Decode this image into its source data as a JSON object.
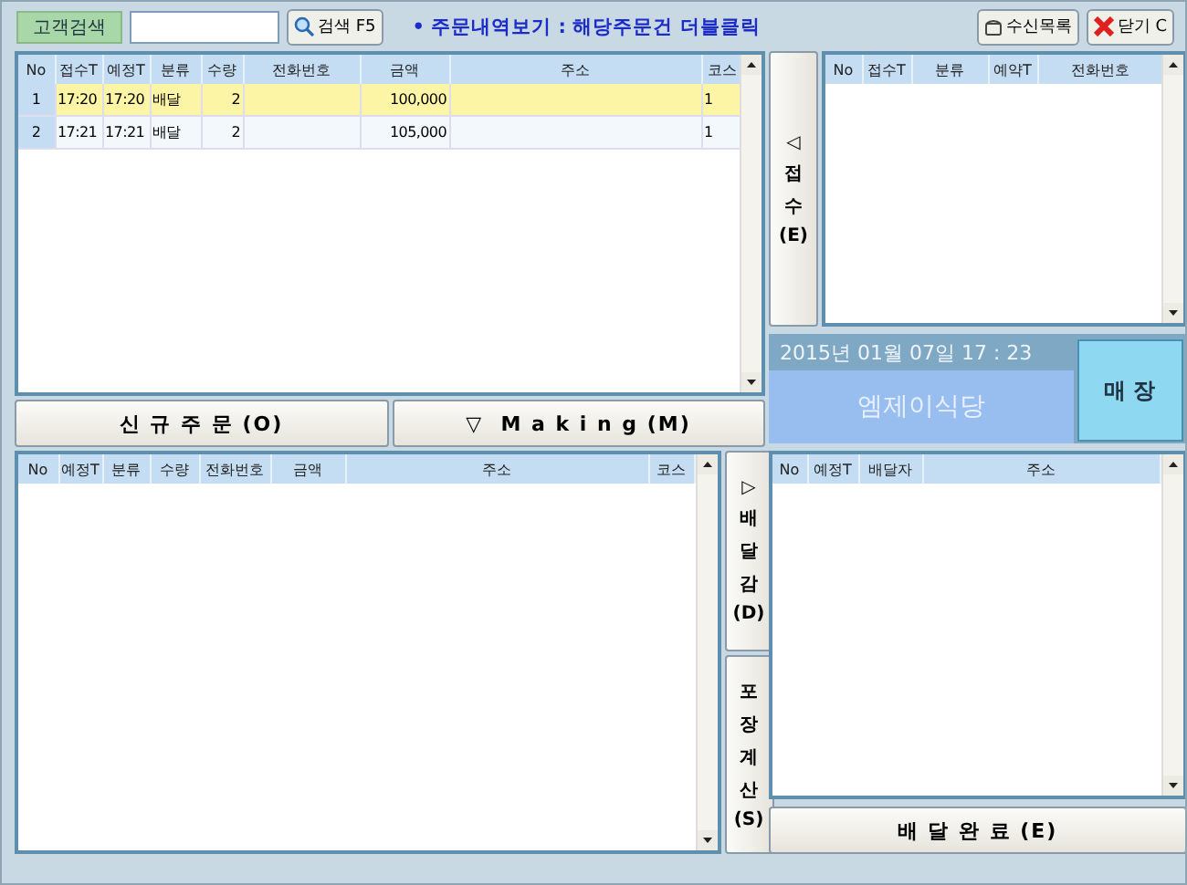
{
  "toolbar": {
    "customer_search": "고객검색",
    "search_button": "검색 F5",
    "notice": "• 주문내역보기 : 해당주문건 더블클릭",
    "received_list": "수신목록",
    "close": "닫기 C"
  },
  "orders": {
    "columns": [
      "No",
      "접수T",
      "예정T",
      "분류",
      "수량",
      "전화번호",
      "금액",
      "주소",
      "코스"
    ],
    "rows": [
      {
        "cells": [
          "1",
          "17:20",
          "17:20",
          "배달",
          "2",
          "",
          "100,000",
          "",
          "1"
        ],
        "selected": true
      },
      {
        "cells": [
          "2",
          "17:21",
          "17:21",
          "배달",
          "2",
          "",
          "105,000",
          "",
          "1"
        ],
        "selected": false
      }
    ]
  },
  "order_buttons": [
    "신 규 주 문 (O)",
    "▽  M a k i n g (M)"
  ],
  "delivery": {
    "columns": [
      "No",
      "예정T",
      "분류",
      "수량",
      "전화번호",
      "금액",
      "주소",
      "코스"
    ]
  },
  "side_buttons": [
    {
      "lines": [
        "▷",
        "배",
        "달",
        "감",
        "(D)"
      ]
    },
    {
      "lines": [
        "포",
        "장",
        "계",
        "산",
        "(S)"
      ]
    }
  ],
  "receipt_button": {
    "lines": [
      "◁",
      "접",
      "수",
      "(E)"
    ]
  },
  "receipts": {
    "columns": [
      "No",
      "접수T",
      "분류",
      "예약T",
      "전화번호"
    ]
  },
  "status": {
    "datetime": "2015년 01월 07일 17 : 23",
    "store": "엠제이식당",
    "hall_button": "매 장"
  },
  "dispatch": {
    "columns": [
      "No",
      "예정T",
      "배달자",
      "주소"
    ]
  },
  "complete_button": "배 달 완 료 (E)"
}
